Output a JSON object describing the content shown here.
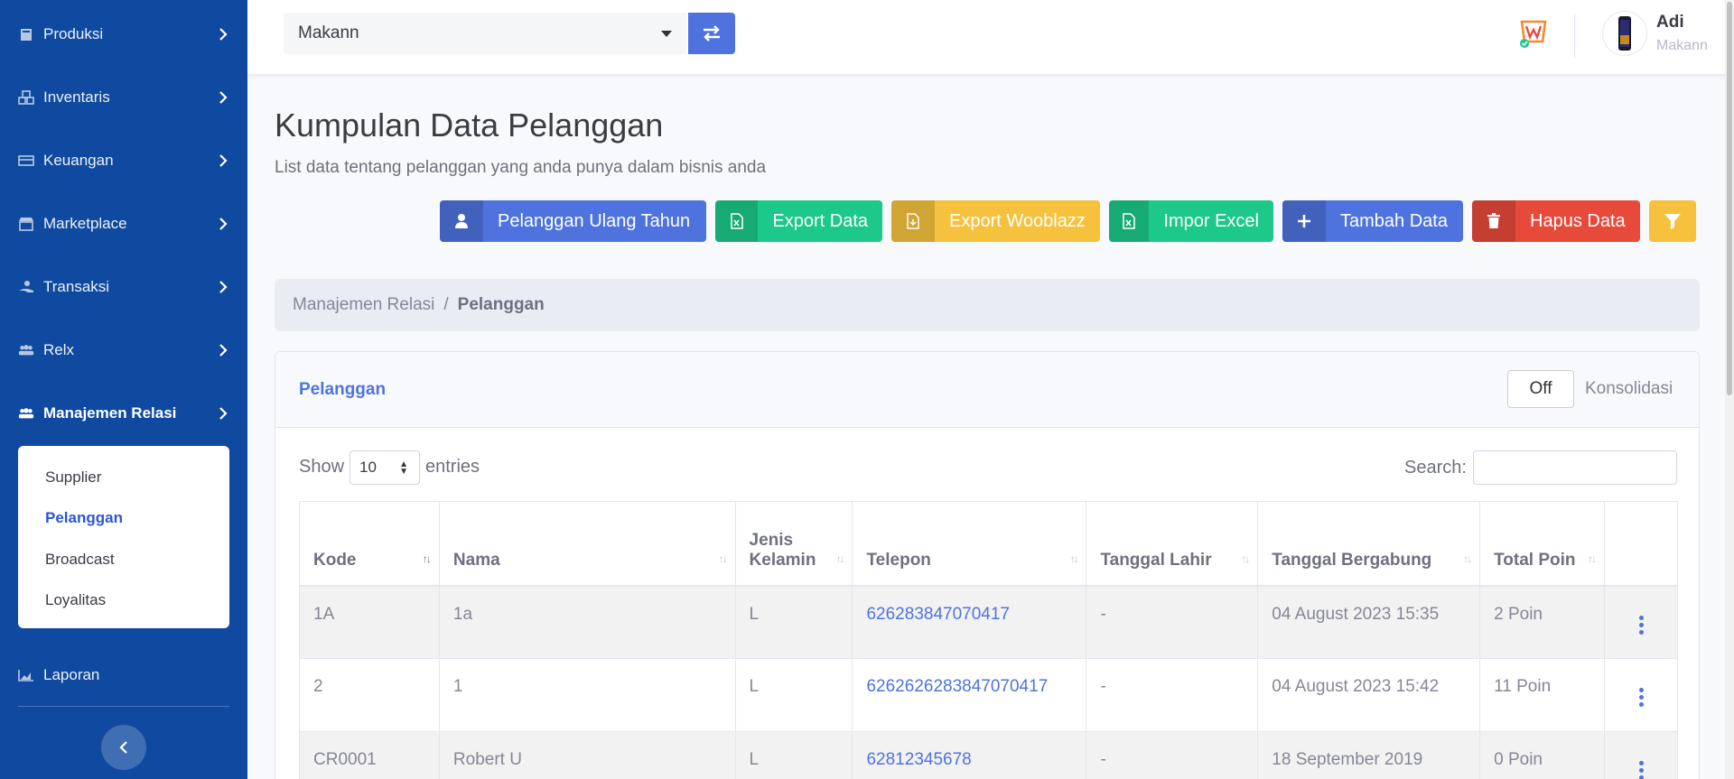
{
  "sidebar": {
    "items": [
      {
        "label": "Produksi",
        "icon": "factory-icon"
      },
      {
        "label": "Inventaris",
        "icon": "boxes-icon"
      },
      {
        "label": "Keuangan",
        "icon": "money-icon"
      },
      {
        "label": "Marketplace",
        "icon": "store-icon"
      },
      {
        "label": "Transaksi",
        "icon": "hand-coins-icon"
      },
      {
        "label": "Relx",
        "icon": "users-icon"
      },
      {
        "label": "Manajemen Relasi",
        "icon": "user-group-icon"
      },
      {
        "label": "Laporan",
        "icon": "chart-area-icon"
      }
    ],
    "submenu": [
      "Supplier",
      "Pelanggan",
      "Broadcast",
      "Loyalitas"
    ],
    "active_sub": "Pelanggan"
  },
  "topbar": {
    "store": "Makann",
    "user_name": "Adi",
    "user_store": "Makann"
  },
  "page": {
    "title": "Kumpulan Data Pelanggan",
    "subtitle": "List data tentang pelanggan yang anda punya dalam bisnis anda"
  },
  "actions": [
    {
      "label": "Pelanggan Ulang Tahun",
      "color": "#4e73df",
      "icon": "user-icon"
    },
    {
      "label": "Export Data",
      "color": "#1cc88a",
      "icon": "excel-icon"
    },
    {
      "label": "Export Wooblazz",
      "color": "#f6c23e",
      "icon": "file-download-icon"
    },
    {
      "label": "Impor Excel",
      "color": "#1cc88a",
      "icon": "excel-icon"
    },
    {
      "label": "Tambah Data",
      "color": "#4e73df",
      "icon": "plus-icon"
    },
    {
      "label": "Hapus Data",
      "color": "#e74a3b",
      "icon": "trash-icon"
    }
  ],
  "breadcrumb": {
    "parent": "Manajemen Relasi",
    "separator": "/",
    "current": "Pelanggan"
  },
  "card": {
    "title": "Pelanggan",
    "toggle": "Off",
    "toggle_label": "Konsolidasi",
    "show": "Show",
    "length": "10",
    "entries": "entries",
    "search": "Search:"
  },
  "table": {
    "headers": [
      "Kode",
      "Nama",
      "Jenis Kelamin",
      "Telepon",
      "Tanggal Lahir",
      "Tanggal Bergabung",
      "Total Poin",
      ""
    ],
    "rows": [
      [
        "1A",
        "1a",
        "L",
        "626283847070417",
        "-",
        "04 August 2023 15:35",
        "2 Poin"
      ],
      [
        "2",
        "1",
        "L",
        "6262626283847070417",
        "-",
        "04 August 2023 15:42",
        "11 Poin"
      ],
      [
        "CR0001",
        "Robert U",
        "L",
        "62812345678",
        "-",
        "18 September 2019",
        "0 Poin"
      ]
    ]
  }
}
